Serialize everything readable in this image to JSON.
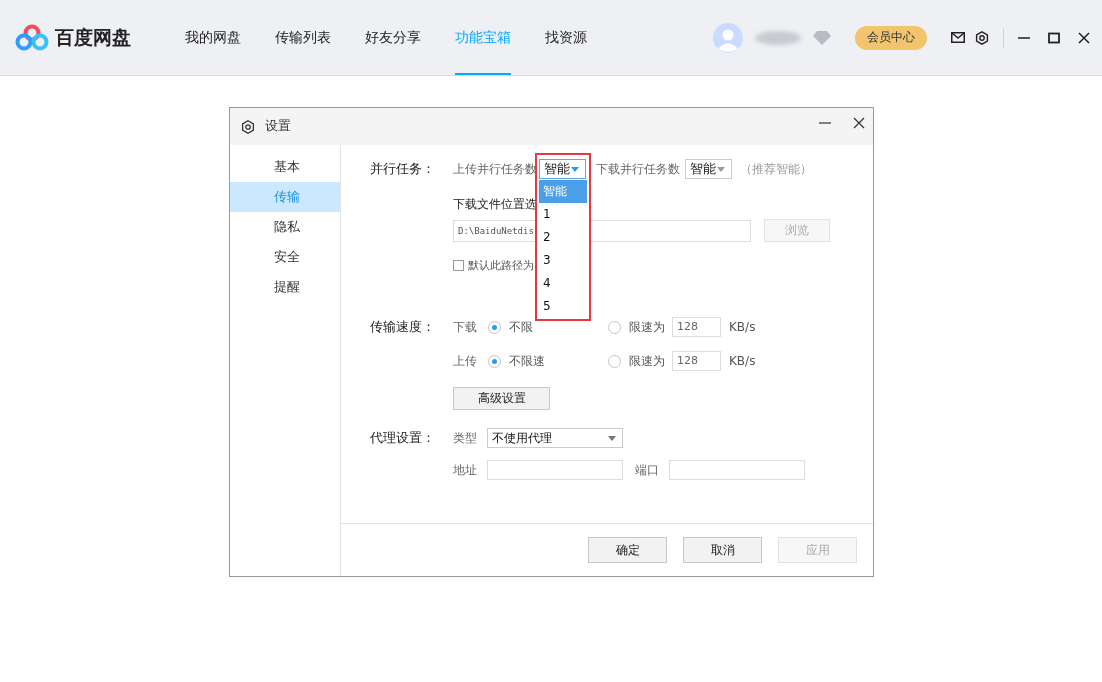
{
  "app": {
    "logo_text": "百度网盘",
    "nav": [
      {
        "label": "我的网盘",
        "selected": false
      },
      {
        "label": "传输列表",
        "selected": false
      },
      {
        "label": "好友分享",
        "selected": false
      },
      {
        "label": "功能宝箱",
        "selected": true
      },
      {
        "label": "找资源",
        "selected": false
      }
    ],
    "vip_button": "会员中心"
  },
  "dialog": {
    "title": "设置",
    "sidebar": [
      {
        "label": "基本",
        "selected": false
      },
      {
        "label": "传输",
        "selected": true
      },
      {
        "label": "隐私",
        "selected": false
      },
      {
        "label": "安全",
        "selected": false
      },
      {
        "label": "提醒",
        "selected": false
      }
    ],
    "parallel": {
      "label": "并行任务：",
      "upload_label": "上传并行任务数",
      "upload_value": "智能",
      "upload_open": true,
      "download_label": "下载并行任务数",
      "download_value": "智能",
      "hint": "（推荐智能）",
      "options": [
        {
          "label": "智能",
          "selected": true
        },
        {
          "label": "1",
          "selected": false
        },
        {
          "label": "2",
          "selected": false
        },
        {
          "label": "3",
          "selected": false
        },
        {
          "label": "4",
          "selected": false
        },
        {
          "label": "5",
          "selected": false
        }
      ]
    },
    "location": {
      "label": "下载文件位置选",
      "path": "D:\\BaiduNetdis",
      "browse": {
        "label": "浏览",
        "disabled": true
      },
      "default_label": "默认此路径为",
      "default_checked": false
    },
    "speed": {
      "label": "传输速度：",
      "rows": [
        {
          "direction": "下载",
          "options": [
            {
              "label": "不限",
              "selected": true
            },
            {
              "label": "限速为",
              "selected": false
            }
          ],
          "limit_value": "128",
          "unit": "KB/s"
        },
        {
          "direction": "上传",
          "options": [
            {
              "label": "不限速",
              "selected": true
            },
            {
              "label": "限速为",
              "selected": false
            }
          ],
          "limit_value": "128",
          "unit": "KB/s"
        }
      ]
    },
    "advanced_button": "高级设置",
    "proxy": {
      "label": "代理设置：",
      "type_label": "类型",
      "type_value": "不使用代理",
      "address_label": "地址",
      "port_label": "端口"
    },
    "buttons": [
      {
        "label": "确定",
        "disabled": false
      },
      {
        "label": "取消",
        "disabled": false
      },
      {
        "label": "应用",
        "disabled": true
      }
    ]
  }
}
